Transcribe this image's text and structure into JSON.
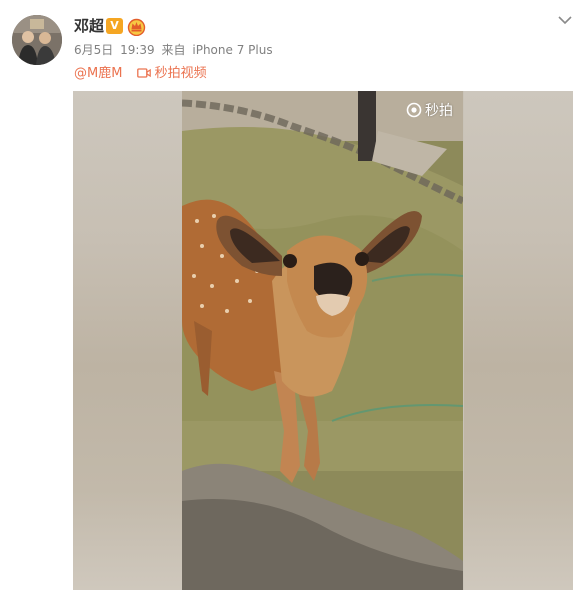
{
  "post": {
    "username": "邓超",
    "verified_badge": "V",
    "date": "6月5日",
    "time": "19:39",
    "source_prefix": "来自",
    "source_device": "iPhone 7 Plus",
    "mention": "@M鹿M",
    "video_link_label": "秒拍视频",
    "accent_color": "#eb7350"
  },
  "media": {
    "watermark": "秒拍",
    "subject": "deer"
  },
  "icons": {
    "verified": "verified-v-icon",
    "crown": "crown-badge-icon",
    "menu": "chevron-down-icon",
    "video": "video-camera-icon",
    "watermark": "miaopai-logo-icon"
  }
}
